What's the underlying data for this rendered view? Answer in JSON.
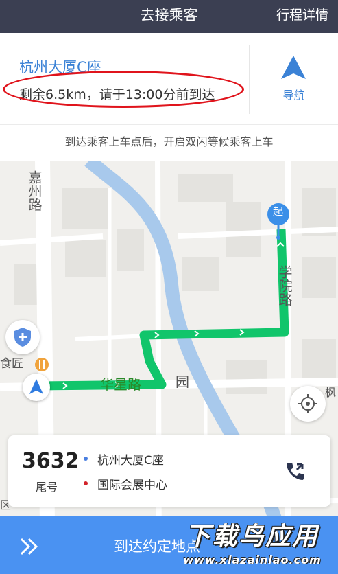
{
  "topbar": {
    "title": "去接乘客",
    "detail_link": "行程详情"
  },
  "destination": {
    "name": "杭州大厦C座",
    "remaining": "剩余6.5km，请于13:00分前到达",
    "nav_label": "导航"
  },
  "hint": "到达乘客上车点后，开启双闪等候乘客上车",
  "map": {
    "labels": {
      "jiaxing_road": "嘉州路",
      "xueyuan_road": "学院路",
      "huaxing_road": "华星路",
      "garden": "园",
      "restaurant": "食匠",
      "start_marker": "起",
      "right_edge": "枫",
      "left_edge": "区"
    },
    "route_color": "#11c56b"
  },
  "order": {
    "tail_number": "3632",
    "tail_label": "尾号",
    "from": "杭州大厦C座",
    "to": "国际会展中心",
    "from_dot_color": "#4a7fe0",
    "to_dot_color": "#d2232a"
  },
  "action": {
    "label": "到达约定地点"
  },
  "watermark": {
    "main": "下载鸟应用",
    "url": "www.xlazainlao.com"
  }
}
